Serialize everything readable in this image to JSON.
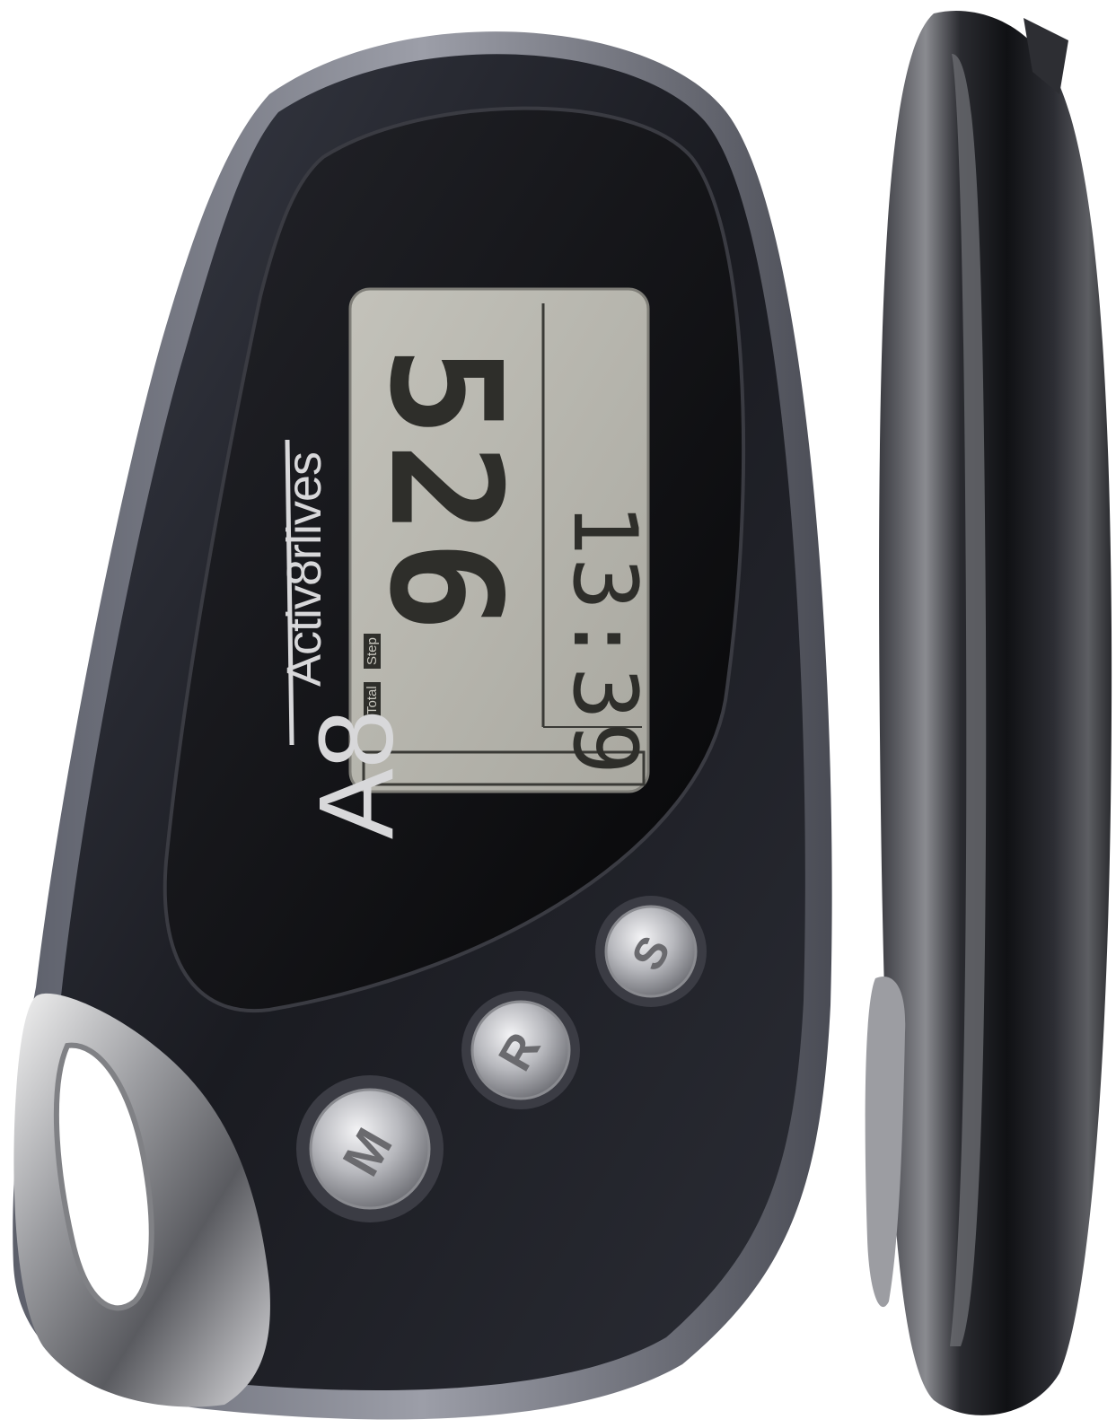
{
  "product": {
    "brand_mark": "A8",
    "brand_name": "Activ8rlives",
    "display": {
      "step_count": "526",
      "clock_time": "13:39",
      "label_total": "Total",
      "label_step": "Step"
    },
    "buttons": [
      {
        "letter": "M"
      },
      {
        "letter": "R"
      },
      {
        "letter": "S"
      }
    ]
  },
  "colors": {
    "body": "#1b1c22",
    "lcd": "#b9b8b0",
    "chrome": "#c8c9cc"
  }
}
